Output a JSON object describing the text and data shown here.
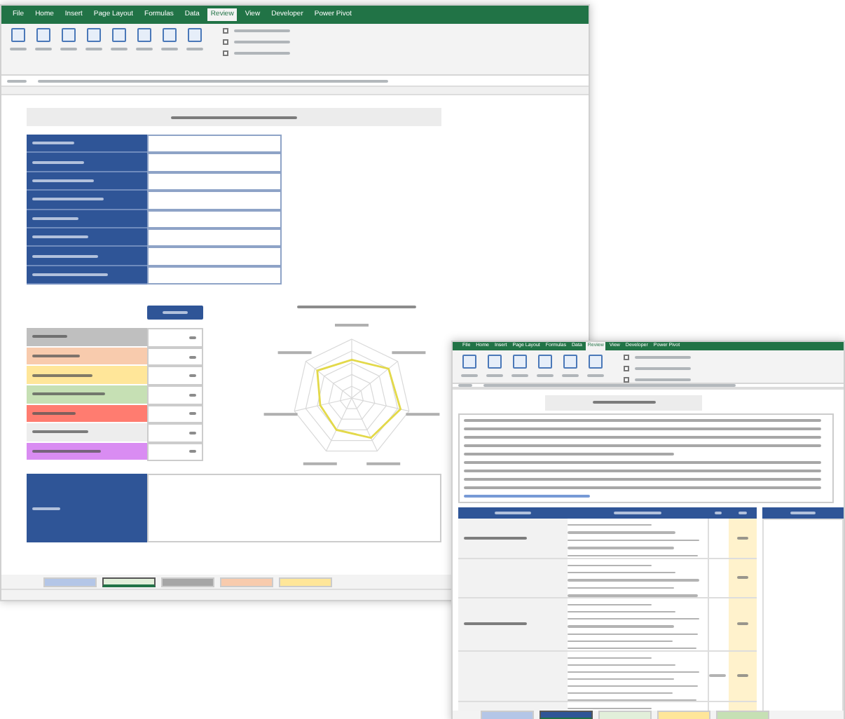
{
  "windows": [
    {
      "ribbon_tabs": [
        {
          "label": "File",
          "selected": false
        },
        {
          "label": "Home",
          "selected": false
        },
        {
          "label": "Insert",
          "selected": false
        },
        {
          "label": "Page Layout",
          "selected": false
        },
        {
          "label": "Formulas",
          "selected": false
        },
        {
          "label": "Data",
          "selected": false
        },
        {
          "label": "Review",
          "selected": true
        },
        {
          "label": "View",
          "selected": false
        },
        {
          "label": "Developer",
          "selected": false
        },
        {
          "label": "Power Pivot",
          "selected": false
        }
      ],
      "ribbon_options": [
        {
          "checked": false
        },
        {
          "checked": false
        },
        {
          "checked": false
        }
      ],
      "score_rows": [
        {
          "color": "#bfbfbf"
        },
        {
          "color": "#f8cbad"
        },
        {
          "color": "#ffe699"
        },
        {
          "color": "#c6e0b4"
        },
        {
          "color": "#ff7c70"
        },
        {
          "color": "#ededed"
        },
        {
          "color": "#d98cf2"
        }
      ],
      "sheet_tabs": [
        {
          "color": "#b4c6e7",
          "selected": false
        },
        {
          "color": "#e2efda",
          "selected": true
        },
        {
          "color": "#a6a6a6",
          "selected": false
        },
        {
          "color": "#f8cbad",
          "selected": false
        },
        {
          "color": "#ffe699",
          "selected": false
        }
      ]
    },
    {
      "ribbon_tabs": [
        {
          "label": "File",
          "selected": false
        },
        {
          "label": "Home",
          "selected": false
        },
        {
          "label": "Insert",
          "selected": false
        },
        {
          "label": "Page Layout",
          "selected": false
        },
        {
          "label": "Formulas",
          "selected": false
        },
        {
          "label": "Data",
          "selected": false
        },
        {
          "label": "Review",
          "selected": true
        },
        {
          "label": "View",
          "selected": false
        },
        {
          "label": "Developer",
          "selected": false
        },
        {
          "label": "Power Pivot",
          "selected": false
        }
      ],
      "ribbon_options": [
        {
          "checked": false
        },
        {
          "checked": false
        },
        {
          "checked": false
        }
      ],
      "sheet_tabs": [
        {
          "color": "#b4c6e7",
          "selected": false
        },
        {
          "color": "#2f5597",
          "selected": true
        },
        {
          "color": "#e2efda",
          "selected": false
        },
        {
          "color": "#ffe699",
          "selected": false
        },
        {
          "color": "#c6e0b4",
          "selected": false
        }
      ]
    }
  ]
}
